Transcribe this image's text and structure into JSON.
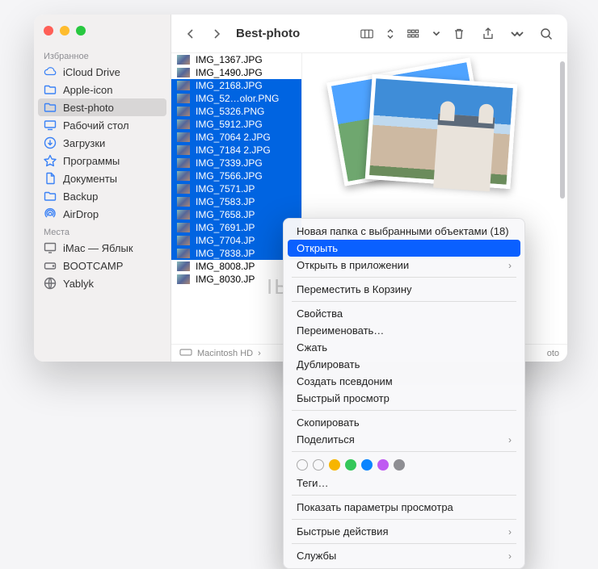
{
  "window_title": "Best-photo",
  "sidebar": {
    "sections": {
      "favorites_label": "Избранное",
      "locations_label": "Места"
    },
    "favorites": [
      {
        "label": "iCloud Drive",
        "icon": "cloud"
      },
      {
        "label": "Apple-icon",
        "icon": "folder"
      },
      {
        "label": "Best-photo",
        "icon": "folder",
        "active": true
      },
      {
        "label": "Рабочий стол",
        "icon": "desktop"
      },
      {
        "label": "Загрузки",
        "icon": "download"
      },
      {
        "label": "Программы",
        "icon": "apps"
      },
      {
        "label": "Документы",
        "icon": "doc"
      },
      {
        "label": "Backup",
        "icon": "folder"
      },
      {
        "label": "AirDrop",
        "icon": "airdrop"
      }
    ],
    "locations": [
      {
        "label": "iMac — Яблык",
        "icon": "display"
      },
      {
        "label": "BOOTCAMP",
        "icon": "disk"
      },
      {
        "label": "Yablyk",
        "icon": "network"
      }
    ]
  },
  "files": [
    {
      "name": "IMG_1367.JPG",
      "selected": false
    },
    {
      "name": "IMG_1490.JPG",
      "selected": false
    },
    {
      "name": "IMG_2168.JPG",
      "selected": true
    },
    {
      "name": "IMG_52…olor.PNG",
      "selected": true
    },
    {
      "name": "IMG_5326.PNG",
      "selected": true
    },
    {
      "name": "IMG_5912.JPG",
      "selected": true
    },
    {
      "name": "IMG_7064 2.JPG",
      "selected": true
    },
    {
      "name": "IMG_7184 2.JPG",
      "selected": true
    },
    {
      "name": "IMG_7339.JPG",
      "selected": true
    },
    {
      "name": "IMG_7566.JPG",
      "selected": true
    },
    {
      "name": "IMG_7571.JP",
      "selected": true
    },
    {
      "name": "IMG_7583.JP",
      "selected": true
    },
    {
      "name": "IMG_7658.JP",
      "selected": true
    },
    {
      "name": "IMG_7691.JP",
      "selected": true
    },
    {
      "name": "IMG_7704.JP",
      "selected": true
    },
    {
      "name": "IMG_7838.JP",
      "selected": true
    },
    {
      "name": "IMG_8008.JP",
      "selected": false
    },
    {
      "name": "IMG_8030.JP",
      "selected": false
    }
  ],
  "path_bar": {
    "root": "Macintosh HD",
    "tail": "oto"
  },
  "context_menu": {
    "new_folder": "Новая папка с выбранными объектами (18)",
    "open": "Открыть",
    "open_with": "Открыть в приложении",
    "trash": "Переместить в Корзину",
    "info": "Свойства",
    "rename": "Переименовать…",
    "compress": "Сжать",
    "duplicate": "Дублировать",
    "alias": "Создать псевдоним",
    "quicklook": "Быстрый просмотр",
    "copy": "Скопировать",
    "share": "Поделиться",
    "tags_label": "Теги…",
    "view_options": "Показать параметры просмотра",
    "quick_actions": "Быстрые действия",
    "services": "Службы"
  },
  "tag_colors": [
    "transparent",
    "transparent",
    "#f7b500",
    "#34c759",
    "#0a84ff",
    "#bf5af2",
    "#8e8e93"
  ]
}
